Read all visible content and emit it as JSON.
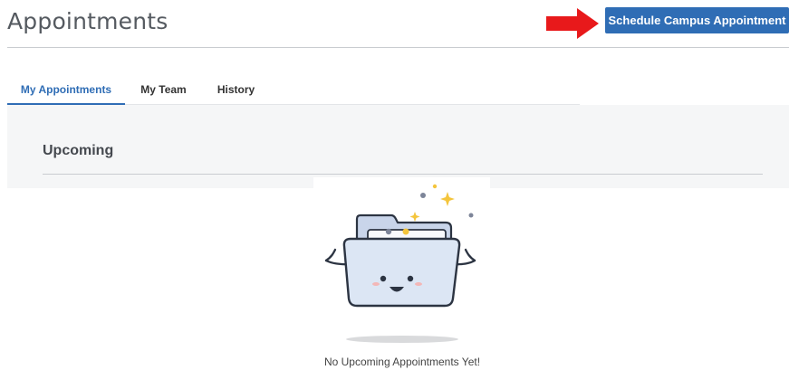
{
  "header": {
    "title": "Appointments",
    "primary_action_label": "Schedule Campus Appointment"
  },
  "tabs": [
    {
      "label": "My Appointments",
      "active": true
    },
    {
      "label": "My Team",
      "active": false
    },
    {
      "label": "History",
      "active": false
    }
  ],
  "section": {
    "title": "Upcoming"
  },
  "empty_state": {
    "illustration": "happy-folder-icon",
    "message": "No Upcoming Appointments Yet!"
  },
  "annotation": {
    "icon": "red-arrow-icon",
    "color": "#e8191b"
  },
  "colors": {
    "accent": "#2f6db5",
    "panel": "#f5f6f7"
  }
}
